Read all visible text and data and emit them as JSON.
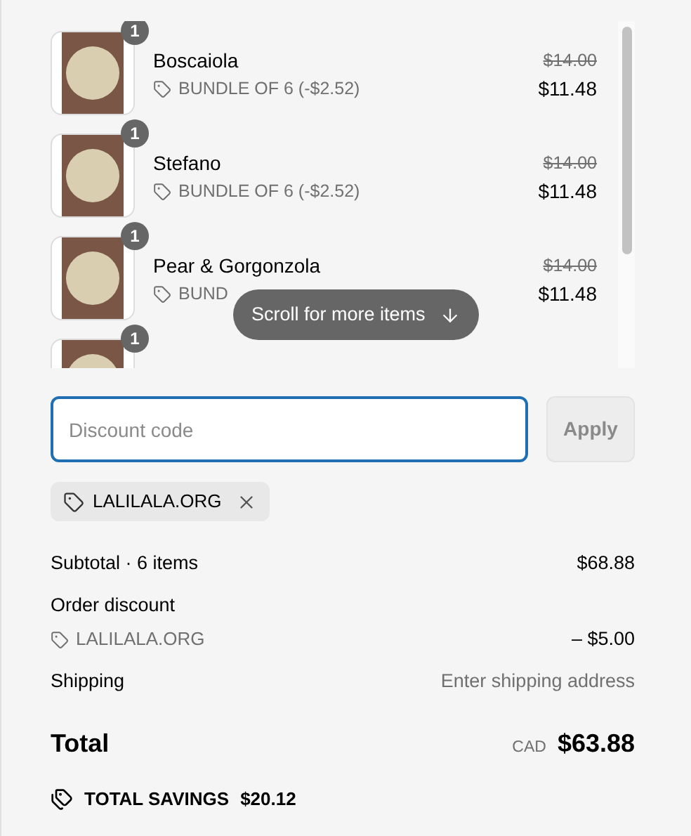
{
  "items": [
    {
      "name": "Boscaiola",
      "discount_label": "BUNDLE OF 6 (-$2.52)",
      "original_price": "$14.00",
      "price": "$11.48",
      "quantity": "1"
    },
    {
      "name": "Stefano",
      "discount_label": "BUNDLE OF 6 (-$2.52)",
      "original_price": "$14.00",
      "price": "$11.48",
      "quantity": "1"
    },
    {
      "name": "Pear & Gorgonzola",
      "discount_label": "BUND",
      "original_price": "$14.00",
      "price": "$11.48",
      "quantity": "1"
    },
    {
      "quantity": "1"
    }
  ],
  "scroll_hint": "Scroll for more items",
  "discount": {
    "placeholder": "Discount code",
    "focused": true,
    "apply_button": "Apply",
    "apply_disabled": true
  },
  "applied_codes": [
    {
      "code": "LALILALA.ORG"
    }
  ],
  "summary": {
    "subtotal_label": "Subtotal · 6 items",
    "subtotal_value": "$68.88",
    "order_discount_label": "Order discount",
    "order_discount_code": "LALILALA.ORG",
    "order_discount_value": "– $5.00",
    "shipping_label": "Shipping",
    "shipping_value": "Enter shipping address",
    "total_label": "Total",
    "currency": "CAD",
    "total_value": "$63.88",
    "savings_label": "TOTAL SAVINGS",
    "savings_value": "$20.12"
  }
}
